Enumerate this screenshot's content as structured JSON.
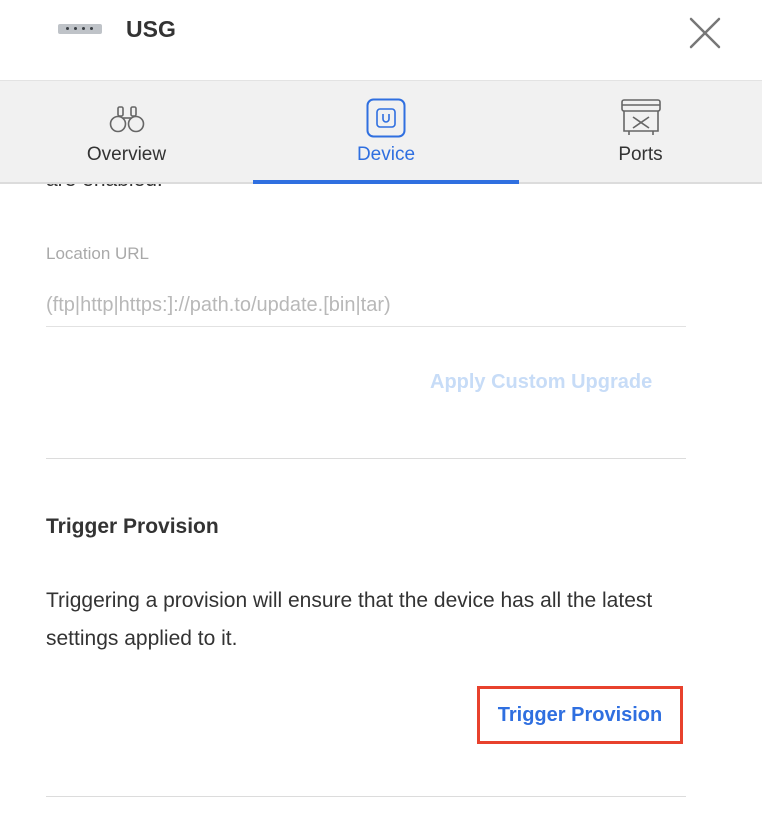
{
  "header": {
    "title": "USG",
    "device_icon": "usg-device-icon",
    "close_icon": "close-icon"
  },
  "tabs": [
    {
      "label": "Overview",
      "icon": "binoculars-icon",
      "active": false
    },
    {
      "label": "Device",
      "icon": "device-icon",
      "active": true
    },
    {
      "label": "Ports",
      "icon": "ports-icon",
      "active": false
    }
  ],
  "content": {
    "cut_off_text": "are enabled.",
    "custom_upgrade": {
      "label": "Location URL",
      "placeholder": "(ftp|http|https:]://path.to/update.[bin|tar)",
      "value": "",
      "button_label": "Apply Custom Upgrade"
    },
    "trigger_provision": {
      "title": "Trigger Provision",
      "description": "Triggering a provision will ensure that the device has all the latest settings applied to it.",
      "button_label": "Trigger Provision"
    }
  },
  "colors": {
    "accent": "#2f6fe0",
    "highlight_border": "#e8412d",
    "disabled_link": "#c7dcf7",
    "tab_background": "#f1f1f1"
  }
}
